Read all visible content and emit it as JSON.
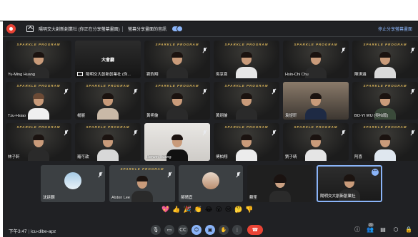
{
  "top_bar": {
    "presenting_text": "陽明交大創新創業社 (你正在分享螢幕畫面)",
    "share_audio_label": "螢幕分享畫面的音訊",
    "stop_sharing_label": "停止分享螢幕畫面"
  },
  "grid": {
    "brand": "SPARKLE PROGRAM",
    "hall_title": "大會廳",
    "tiles": [
      {
        "name": "Yu-Ming Huang"
      },
      {
        "name": "陽明交大創新創業社 (你..."
      },
      {
        "name": "劉鈞翔"
      },
      {
        "name": "吳享恩"
      },
      {
        "name": "Hsin-Chi Chu"
      },
      {
        "name": "陳琪涵"
      },
      {
        "name": "Tzu-Hsiao"
      },
      {
        "name": "楊展"
      },
      {
        "name": "黃明倫"
      },
      {
        "name": "黃翊倫"
      },
      {
        "name": "袁煜軒"
      },
      {
        "name": "BO-YI WU (吳柏毅)"
      },
      {
        "name": "林子軒"
      },
      {
        "name": "羅可歆"
      },
      {
        "name": "Berwin Huang"
      },
      {
        "name": "傅柏翔"
      },
      {
        "name": "劉子晴"
      },
      {
        "name": "阿喜"
      }
    ]
  },
  "strip": {
    "tiles": [
      {
        "name": "沈廷鋼"
      },
      {
        "name": "Alston Lee"
      },
      {
        "name": "郝晴宜"
      },
      {
        "name": "蘇笙"
      },
      {
        "name": "陽明交大創新創業社"
      }
    ]
  },
  "reactions": [
    "💖",
    "👍",
    "🎉",
    "👏",
    "😂",
    "😮",
    "😢",
    "🤔",
    "👎"
  ],
  "controls": {
    "clock": "下午3:47",
    "meeting_code": "icu-dibe-apz",
    "participant_count": "23"
  },
  "colors": {
    "background": "#202124",
    "accent": "#8ab4f8",
    "end_call": "#ea4335",
    "brand_gold": "#d9b45a"
  }
}
